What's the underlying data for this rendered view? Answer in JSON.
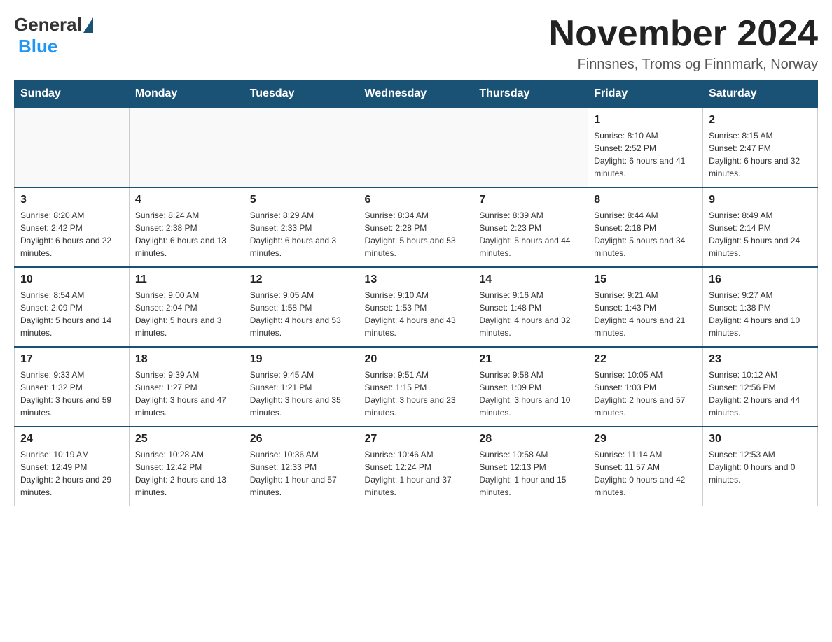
{
  "header": {
    "logo": {
      "general": "General",
      "triangle": "▶",
      "blue": "Blue"
    },
    "title": "November 2024",
    "location": "Finnsnes, Troms og Finnmark, Norway"
  },
  "days_of_week": [
    "Sunday",
    "Monday",
    "Tuesday",
    "Wednesday",
    "Thursday",
    "Friday",
    "Saturday"
  ],
  "weeks": [
    [
      {
        "day": "",
        "info": ""
      },
      {
        "day": "",
        "info": ""
      },
      {
        "day": "",
        "info": ""
      },
      {
        "day": "",
        "info": ""
      },
      {
        "day": "",
        "info": ""
      },
      {
        "day": "1",
        "info": "Sunrise: 8:10 AM\nSunset: 2:52 PM\nDaylight: 6 hours and 41 minutes."
      },
      {
        "day": "2",
        "info": "Sunrise: 8:15 AM\nSunset: 2:47 PM\nDaylight: 6 hours and 32 minutes."
      }
    ],
    [
      {
        "day": "3",
        "info": "Sunrise: 8:20 AM\nSunset: 2:42 PM\nDaylight: 6 hours and 22 minutes."
      },
      {
        "day": "4",
        "info": "Sunrise: 8:24 AM\nSunset: 2:38 PM\nDaylight: 6 hours and 13 minutes."
      },
      {
        "day": "5",
        "info": "Sunrise: 8:29 AM\nSunset: 2:33 PM\nDaylight: 6 hours and 3 minutes."
      },
      {
        "day": "6",
        "info": "Sunrise: 8:34 AM\nSunset: 2:28 PM\nDaylight: 5 hours and 53 minutes."
      },
      {
        "day": "7",
        "info": "Sunrise: 8:39 AM\nSunset: 2:23 PM\nDaylight: 5 hours and 44 minutes."
      },
      {
        "day": "8",
        "info": "Sunrise: 8:44 AM\nSunset: 2:18 PM\nDaylight: 5 hours and 34 minutes."
      },
      {
        "day": "9",
        "info": "Sunrise: 8:49 AM\nSunset: 2:14 PM\nDaylight: 5 hours and 24 minutes."
      }
    ],
    [
      {
        "day": "10",
        "info": "Sunrise: 8:54 AM\nSunset: 2:09 PM\nDaylight: 5 hours and 14 minutes."
      },
      {
        "day": "11",
        "info": "Sunrise: 9:00 AM\nSunset: 2:04 PM\nDaylight: 5 hours and 3 minutes."
      },
      {
        "day": "12",
        "info": "Sunrise: 9:05 AM\nSunset: 1:58 PM\nDaylight: 4 hours and 53 minutes."
      },
      {
        "day": "13",
        "info": "Sunrise: 9:10 AM\nSunset: 1:53 PM\nDaylight: 4 hours and 43 minutes."
      },
      {
        "day": "14",
        "info": "Sunrise: 9:16 AM\nSunset: 1:48 PM\nDaylight: 4 hours and 32 minutes."
      },
      {
        "day": "15",
        "info": "Sunrise: 9:21 AM\nSunset: 1:43 PM\nDaylight: 4 hours and 21 minutes."
      },
      {
        "day": "16",
        "info": "Sunrise: 9:27 AM\nSunset: 1:38 PM\nDaylight: 4 hours and 10 minutes."
      }
    ],
    [
      {
        "day": "17",
        "info": "Sunrise: 9:33 AM\nSunset: 1:32 PM\nDaylight: 3 hours and 59 minutes."
      },
      {
        "day": "18",
        "info": "Sunrise: 9:39 AM\nSunset: 1:27 PM\nDaylight: 3 hours and 47 minutes."
      },
      {
        "day": "19",
        "info": "Sunrise: 9:45 AM\nSunset: 1:21 PM\nDaylight: 3 hours and 35 minutes."
      },
      {
        "day": "20",
        "info": "Sunrise: 9:51 AM\nSunset: 1:15 PM\nDaylight: 3 hours and 23 minutes."
      },
      {
        "day": "21",
        "info": "Sunrise: 9:58 AM\nSunset: 1:09 PM\nDaylight: 3 hours and 10 minutes."
      },
      {
        "day": "22",
        "info": "Sunrise: 10:05 AM\nSunset: 1:03 PM\nDaylight: 2 hours and 57 minutes."
      },
      {
        "day": "23",
        "info": "Sunrise: 10:12 AM\nSunset: 12:56 PM\nDaylight: 2 hours and 44 minutes."
      }
    ],
    [
      {
        "day": "24",
        "info": "Sunrise: 10:19 AM\nSunset: 12:49 PM\nDaylight: 2 hours and 29 minutes."
      },
      {
        "day": "25",
        "info": "Sunrise: 10:28 AM\nSunset: 12:42 PM\nDaylight: 2 hours and 13 minutes."
      },
      {
        "day": "26",
        "info": "Sunrise: 10:36 AM\nSunset: 12:33 PM\nDaylight: 1 hour and 57 minutes."
      },
      {
        "day": "27",
        "info": "Sunrise: 10:46 AM\nSunset: 12:24 PM\nDaylight: 1 hour and 37 minutes."
      },
      {
        "day": "28",
        "info": "Sunrise: 10:58 AM\nSunset: 12:13 PM\nDaylight: 1 hour and 15 minutes."
      },
      {
        "day": "29",
        "info": "Sunrise: 11:14 AM\nSunset: 11:57 AM\nDaylight: 0 hours and 42 minutes."
      },
      {
        "day": "30",
        "info": "Sunset: 12:53 AM\nDaylight: 0 hours and 0 minutes."
      }
    ]
  ]
}
